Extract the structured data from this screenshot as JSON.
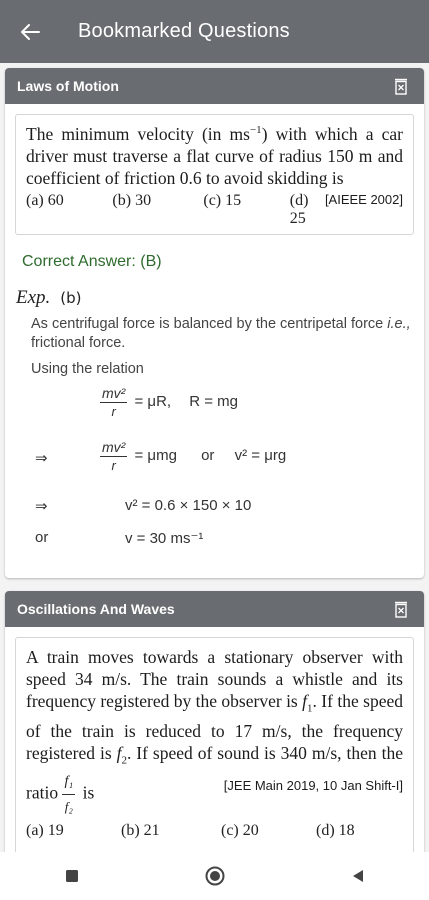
{
  "header": {
    "title": "Bookmarked Questions"
  },
  "card1": {
    "chapter": "Laws of Motion",
    "question_parts": {
      "p1": "The minimum velocity (in ms",
      "sup": "−1",
      "p2": ") with which a car driver must traverse a flat curve of radius 150 m and coefficient of friction 0.6 to avoid skidding is",
      "source": "[AIEEE 2002]"
    },
    "options": [
      "(a) 60",
      "(b) 30",
      "(c) 15",
      "(d) 25"
    ],
    "correct_answer": "Correct Answer: (B)",
    "exp_label": "Exp.",
    "exp_choice": "(b)",
    "explanation": {
      "line1": "As centrifugal force is balanced by the centripetal force ",
      "line1_it": "i.e.,",
      "line1_end": " frictional force.",
      "line2": "Using the relation",
      "eq1_num": "mv²",
      "eq1_den": "r",
      "eq1_rhs": "= μR,",
      "eq1_r": "R = mg",
      "arrow": "⇒",
      "eq2_num": "mv²",
      "eq2_den": "r",
      "eq2_rhs": "= μmg",
      "or": "or",
      "eq2_alt": "v² = μrg",
      "eq3": "v² = 0.6 × 150 × 10",
      "eq4": "v = 30 ms⁻¹"
    }
  },
  "card2": {
    "chapter": "Oscillations And Waves",
    "question_parts": {
      "p1": "A train moves towards a stationary observer with speed 34 m/s. The train sounds a whistle and its frequency registered by the observer is ",
      "f1": "f",
      "p2": ". If the speed of the train is reduced to 17 m/s, the frequency registered is ",
      "p3": ". If speed of sound is 340 m/s, then the ratio ",
      "p4": " is",
      "frac_num": "f₁",
      "frac_den": "f₂",
      "source": "[JEE Main 2019, 10 Jan Shift-I]"
    },
    "options": [
      "(a) 19",
      "(b) 21",
      "(c) 20",
      "(d) 18"
    ]
  },
  "icons": {
    "back": "arrow-left",
    "delete": "trash",
    "nav": [
      "square",
      "circle",
      "triangle-left"
    ]
  },
  "colors": {
    "appbar": "#696c70",
    "answer": "#2f6b2e"
  }
}
